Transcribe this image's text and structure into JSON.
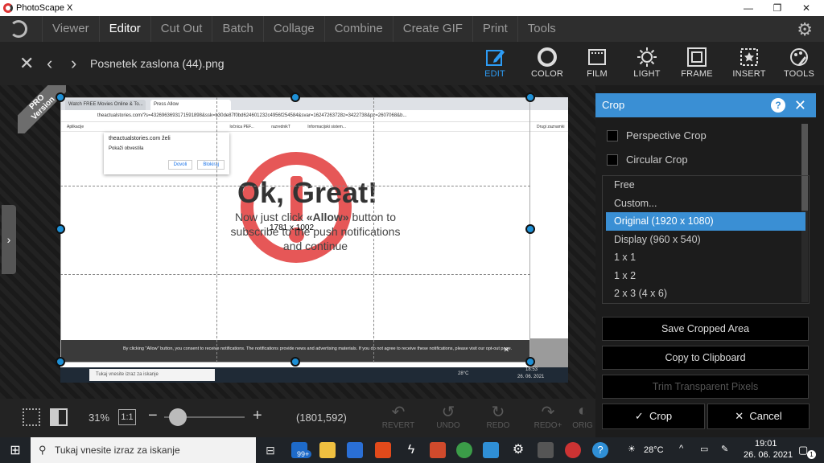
{
  "window": {
    "title": "PhotoScape X",
    "controls": [
      "—",
      "❐",
      "✕"
    ]
  },
  "menu": {
    "tabs": [
      "Viewer",
      "Editor",
      "Cut Out",
      "Batch",
      "Collage",
      "Combine",
      "Create GIF",
      "Print",
      "Tools"
    ],
    "active": "Editor"
  },
  "toolbar": {
    "filename": "Posnetek zaslona (44).png",
    "tools": [
      {
        "label": "EDIT",
        "icon": "edit-icon",
        "active": true
      },
      {
        "label": "COLOR",
        "icon": "color-icon",
        "active": false
      },
      {
        "label": "FILM",
        "icon": "film-icon",
        "active": false
      },
      {
        "label": "LIGHT",
        "icon": "light-icon",
        "active": false
      },
      {
        "label": "FRAME",
        "icon": "frame-icon",
        "active": false
      },
      {
        "label": "INSERT",
        "icon": "insert-icon",
        "active": false
      },
      {
        "label": "TOOLS",
        "icon": "tools-icon",
        "active": false
      }
    ]
  },
  "ribbon": {
    "line1": "PRO",
    "line2": "Version"
  },
  "image": {
    "tab1": "Watch FREE Movies Online & To...",
    "tab2": "Press Allow",
    "url": "theactualstories.com/?s=4326963693171591898&ssk=b30de87f0bd624601232c4956f254584&svar=16247263728z=3422738&pz=2607068&b...",
    "bookmarks": [
      "Aplikacije",
      "ločnica PEF...",
      "razrednikT",
      "Informacijski sistem..."
    ],
    "bookmarks_right": "Drugi zaznamki",
    "perm_site": "theactualstories.com želi",
    "perm_item": "Pokaži obvestila",
    "perm_allow": "Dovoli",
    "perm_block": "Blokiraj",
    "headline": "Ok, Great!",
    "sub1": "Now just click",
    "sub_bold": "«Allow»",
    "sub2": "button to subscribe to the push notifications and continue",
    "size_tag": "1781 x 1002",
    "notice": "By clicking \"Allow\" button, you consent to receive notifications. The notifications provide news and advertising materials. If you do not agree to receive these notifications, please visit our opt-out page.",
    "taskbar_search": "Tukaj vnesite izraz za iskanje",
    "taskbar_weather": "28°C",
    "taskbar_time": "18:53",
    "taskbar_date": "26. 06. 2021"
  },
  "bottom": {
    "zoom": "31%",
    "ratio": "1:1",
    "coords": "(1801,592)",
    "actions": [
      "REVERT",
      "UNDO",
      "REDO",
      "REDO+",
      "ORIG"
    ]
  },
  "panel": {
    "title": "Crop",
    "options": [
      "Perspective Crop",
      "Circular Crop"
    ],
    "ratios": [
      "Free",
      "Custom...",
      "Original (1920 x 1080)",
      "Display (960 x 540)",
      "1 x 1",
      "1 x 2",
      "2 x 3 (4 x 6)"
    ],
    "selected_ratio": "Original (1920 x 1080)",
    "save": "Save Cropped Area",
    "copy": "Copy to Clipboard",
    "trim": "Trim Transparent Pixels",
    "ok": "Crop",
    "cancel": "Cancel"
  },
  "taskbar": {
    "search": "Tukaj vnesite izraz za iskanje",
    "badge": "99+",
    "weather": "28°C",
    "time": "19:01",
    "date": "26. 06. 2021",
    "notif_count": "1"
  },
  "colors": {
    "accent": "#2d9cf5",
    "panel_head": "#3a8fd4",
    "handle": "#1e90d6",
    "alert": "#e23a3a"
  }
}
